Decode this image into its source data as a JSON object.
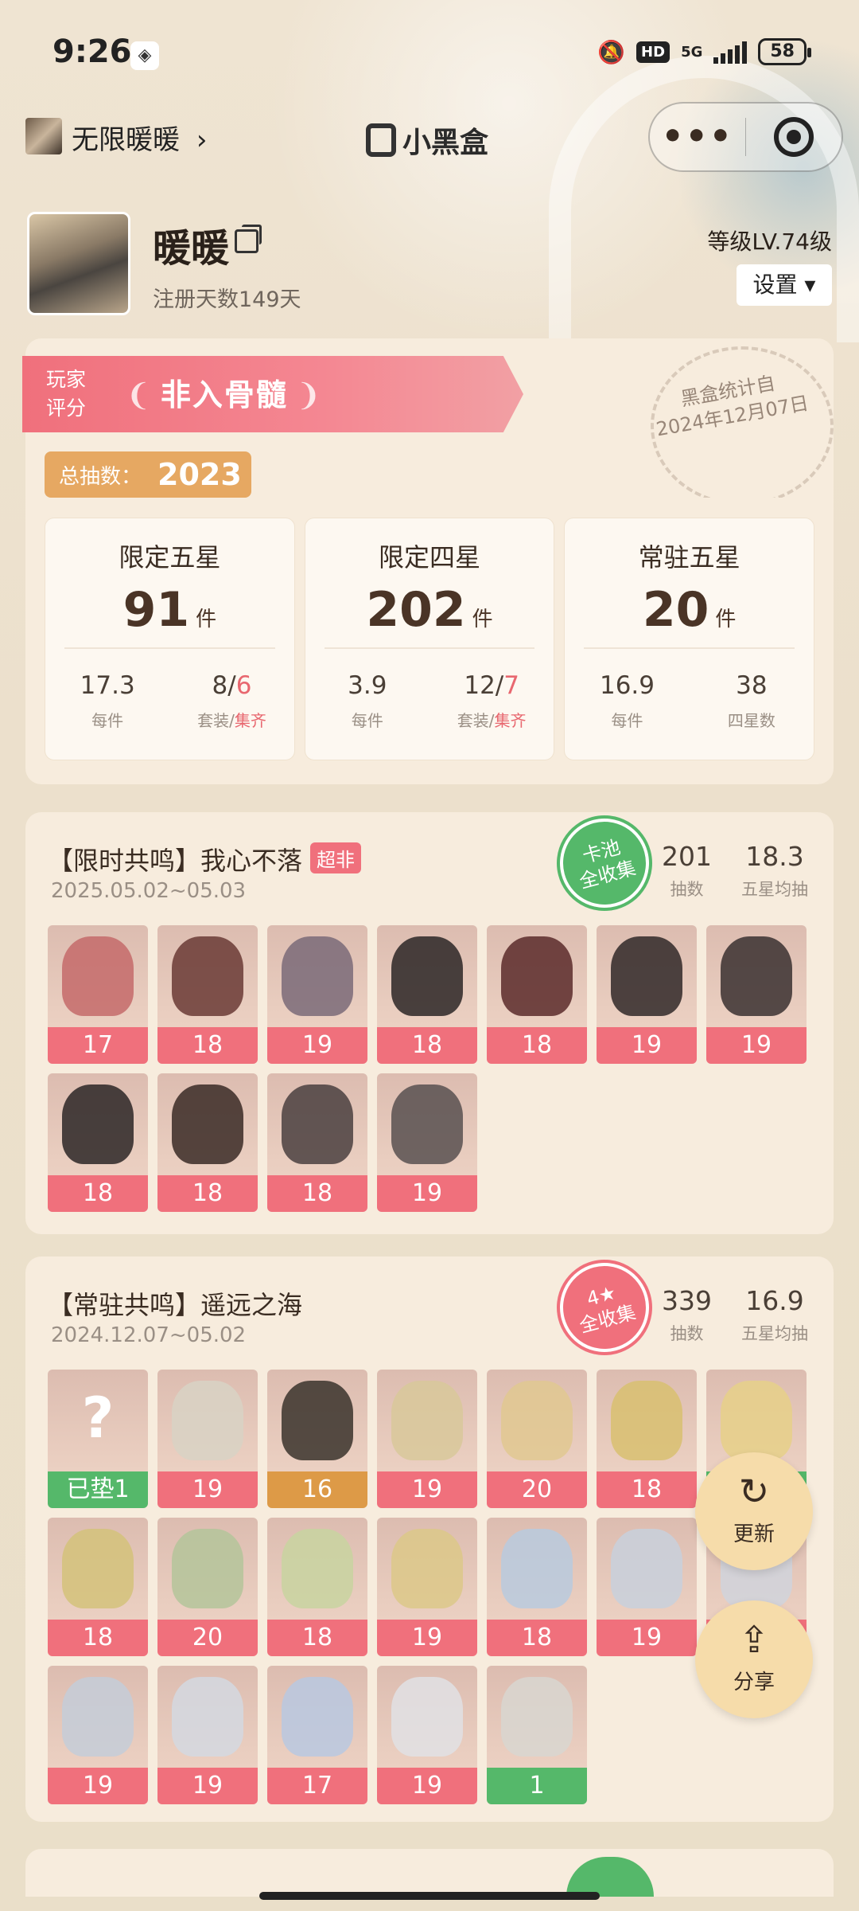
{
  "status_bar": {
    "time": "9:26",
    "hd": "HD",
    "network": "5G",
    "battery": "58"
  },
  "nav": {
    "game_name": "无限暖暖",
    "chevron": "›",
    "brand": "小黑盒",
    "more": "•••"
  },
  "profile": {
    "nickname": "暖暖",
    "register_days": "注册天数149天",
    "level": "等级LV.74级",
    "settings": "设置 ▾"
  },
  "stats": {
    "rating_label_1": "玩家",
    "rating_label_2": "评分",
    "rating_value": "非入骨髓",
    "stamp_line_1": "黑盒统计自",
    "stamp_line_2": "2024年12月07日",
    "draw_total_label": "总抽数：",
    "draw_total_value": "2023",
    "boxes": [
      {
        "title": "限定五星",
        "count": "91",
        "unit": "件",
        "a_val": "17.3",
        "a_key": "每件",
        "b_val_1": "8/",
        "b_val_2": "6",
        "b_key_1": "套装/",
        "b_key_2": "集齐"
      },
      {
        "title": "限定四星",
        "count": "202",
        "unit": "件",
        "a_val": "3.9",
        "a_key": "每件",
        "b_val_1": "12/",
        "b_val_2": "7",
        "b_key_1": "套装/",
        "b_key_2": "集齐"
      },
      {
        "title": "常驻五星",
        "count": "20",
        "unit": "件",
        "a_val": "16.9",
        "a_key": "每件",
        "b_val_1": "38",
        "b_val_2": "",
        "b_key_1": "四星数",
        "b_key_2": ""
      }
    ]
  },
  "pools": [
    {
      "title": "【限时共鸣】我心不落",
      "tag": "超非",
      "date": "2025.05.02~05.03",
      "seal_line_1": "卡池",
      "seal_line_2": "全收集",
      "draws": "201",
      "draws_key": "抽数",
      "avg": "18.3",
      "avg_key": "五星均抽",
      "items": [
        "17",
        "18",
        "19",
        "18",
        "18",
        "19",
        "19",
        "18",
        "18",
        "18",
        "19"
      ]
    },
    {
      "title": "【常驻共鸣】遥远之海",
      "date": "2024.12.07~05.02",
      "seal_line_1": "4★",
      "seal_line_2": "全收集",
      "draws": "339",
      "draws_key": "抽数",
      "avg": "16.9",
      "avg_key": "五星均抽",
      "first_item": "已垫1",
      "items": [
        "19",
        "16",
        "19",
        "20",
        "18",
        "19",
        "18",
        "20",
        "18",
        "19",
        "18",
        "19",
        "20",
        "19",
        "19",
        "17",
        "19",
        "1"
      ]
    }
  ],
  "float_buttons": {
    "refresh": "更新",
    "share": "分享"
  },
  "colors": {
    "accent_red": "#f0707c",
    "green": "#55b86a",
    "orange": "#dd9a47",
    "card_bg": "#f7ecdd"
  }
}
